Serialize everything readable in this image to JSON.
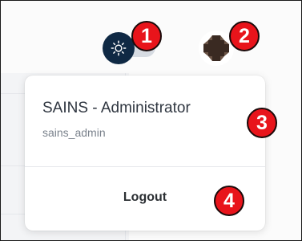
{
  "header": {
    "theme_toggle": {
      "icon": "sun-icon",
      "state": "light",
      "knob_color": "#0f2944",
      "track_color": "#d6dbe2"
    },
    "avatar": {
      "icon": "pixel-avatar"
    }
  },
  "annotations": {
    "badge1": "1",
    "badge2": "2",
    "badge3": "3",
    "badge4": "4",
    "color": "#e8141b"
  },
  "user_menu": {
    "display_name": "SAINS - Administrator",
    "username": "sains_admin",
    "logout_label": "Logout"
  }
}
